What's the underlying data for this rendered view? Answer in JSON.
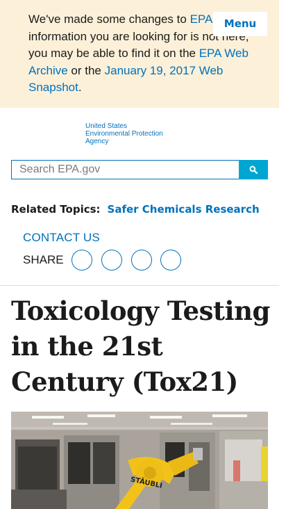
{
  "notice": {
    "text_1": "We've made some changes to ",
    "link_epa": "EPA.",
    "text_2": " If the information you are looking for is not here, you may be able to find it on the ",
    "link_archive": "EPA Web Archive",
    "text_3": " or the ",
    "link_snapshot": "January 19, 2017 Web Snapshot",
    "text_4": "."
  },
  "header": {
    "menu_label": "Menu",
    "logo_line1": "United States",
    "logo_line2": "Environmental Protection",
    "logo_line3": "Agency"
  },
  "search": {
    "placeholder": "Search EPA.gov",
    "icon": "search-icon"
  },
  "related": {
    "label": "Related Topics:",
    "link": "Safer Chemicals Research"
  },
  "contact_label": "CONTACT US",
  "share": {
    "label": "SHARE",
    "buttons": [
      "facebook-icon",
      "twitter-icon",
      "pinterest-icon",
      "email-icon"
    ]
  },
  "page_title": "Toxicology Testing in the 21st Century (Tox21)",
  "hero_image": {
    "robot_label": "STÄUBLI"
  },
  "colors": {
    "notice_bg": "#fcf0d9",
    "link": "#0071bc",
    "search_button": "#00a6d2",
    "robot": "#f2c21a"
  }
}
